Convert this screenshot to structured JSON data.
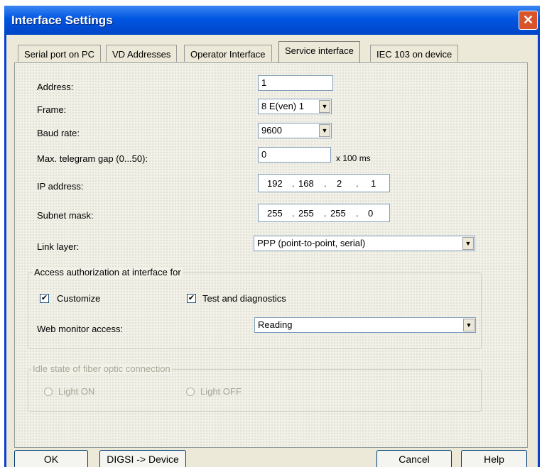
{
  "window": {
    "title": "Interface Settings"
  },
  "tabs": [
    {
      "label": "Serial port on PC"
    },
    {
      "label": "VD Addresses"
    },
    {
      "label": "Operator Interface"
    },
    {
      "label": "Service interface"
    },
    {
      "label": "IEC 103 on device"
    }
  ],
  "form": {
    "address": {
      "label": "Address:",
      "value": "1"
    },
    "frame": {
      "label": "Frame:",
      "value": "8 E(ven) 1"
    },
    "baud": {
      "label": "Baud rate:",
      "value": "9600"
    },
    "gap": {
      "label": "Max. telegram gap (0...50):",
      "value": "0",
      "unit": "x 100 ms"
    },
    "ip": {
      "label": "IP address:",
      "octets": [
        "192",
        "168",
        "2",
        "1"
      ]
    },
    "subnet": {
      "label": "Subnet mask:",
      "octets": [
        "255",
        "255",
        "255",
        "0"
      ]
    },
    "link": {
      "label": "Link layer:",
      "value": "PPP (point-to-point, serial)"
    }
  },
  "access": {
    "legend": "Access authorization at interface for",
    "customize": {
      "label": "Customize",
      "checked": true,
      "mark": "✔"
    },
    "test": {
      "label": "Test and diagnostics",
      "checked": true,
      "mark": "✔"
    },
    "web": {
      "label": "Web monitor access:",
      "value": "Reading"
    }
  },
  "idle": {
    "legend": "Idle state of fiber optic connection",
    "light_on": "Light ON",
    "light_off": "Light OFF"
  },
  "buttons": {
    "ok": "OK",
    "digsi": "DIGSI -> Device",
    "cancel": "Cancel",
    "help": "Help"
  }
}
